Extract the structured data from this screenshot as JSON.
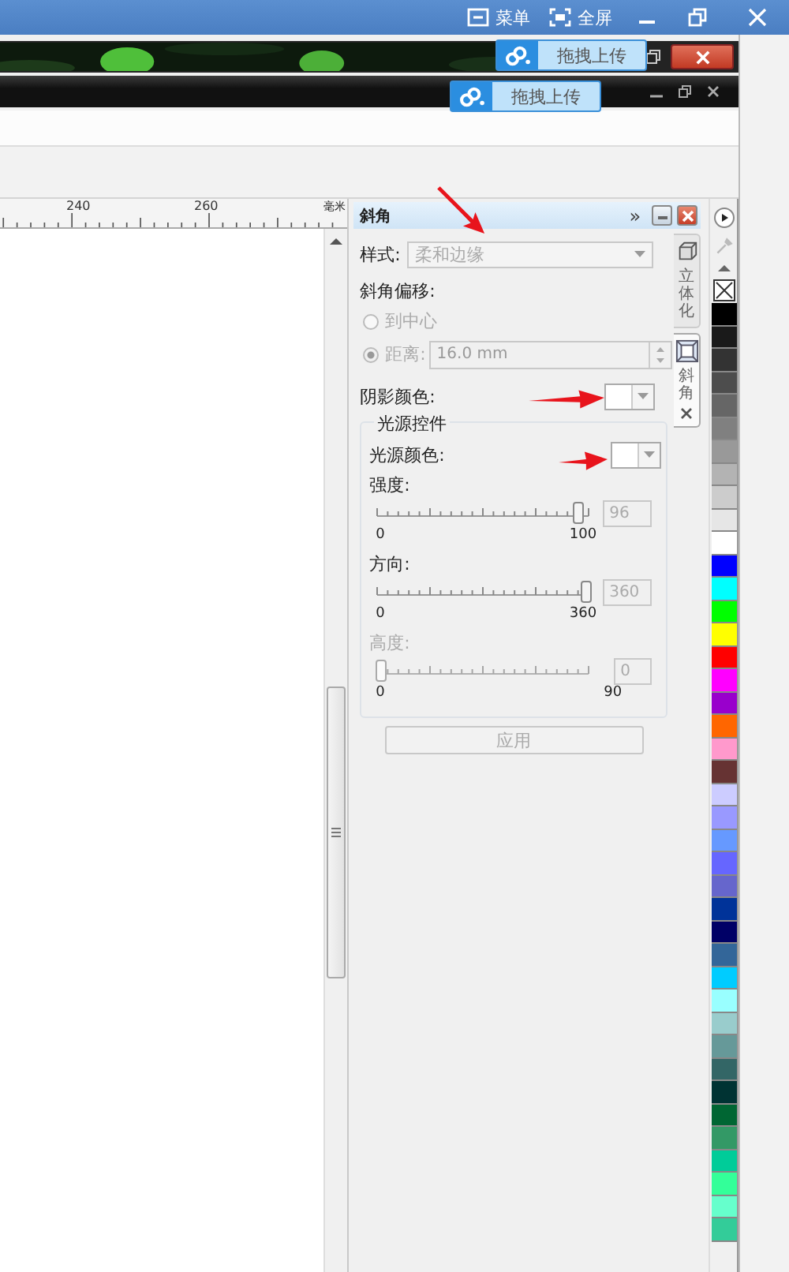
{
  "window": {
    "menu_label": "菜单",
    "fullscreen_label": "全屏"
  },
  "upload_buttons": [
    {
      "label": "拖拽上传"
    },
    {
      "label": "拖拽上传"
    }
  ],
  "ruler": {
    "ticks": [
      "240",
      "260"
    ],
    "unit": "毫米"
  },
  "docker": {
    "title": "斜角",
    "expand_glyph": "»",
    "style": {
      "label": "样式:",
      "value": "柔和边缘",
      "disabled": true
    },
    "offset": {
      "label": "斜角偏移:",
      "distance": "16.0 mm",
      "options": [
        {
          "label": "到中心",
          "selected": false
        },
        {
          "label": "距离:",
          "selected": true
        }
      ]
    },
    "shadow_color_label": "阴影颜色:",
    "light": {
      "title": "光源控件",
      "color_label": "光源颜色:",
      "sliders": [
        {
          "label": "强度:",
          "level": 0.96,
          "value": "96",
          "min": "0",
          "max": "100",
          "disabled": false
        },
        {
          "label": "方向:",
          "level": 1,
          "value": "360",
          "min": "0",
          "max": "360",
          "disabled": false
        },
        {
          "label": "高度:",
          "level": 0,
          "value": "0",
          "min": "0",
          "max": "90",
          "disabled": true
        }
      ]
    },
    "apply_button": "应用",
    "tabs": [
      {
        "label": "立体化",
        "selected": false
      },
      {
        "label": "斜角",
        "selected": true
      }
    ]
  },
  "palette": {
    "swatches": [
      {
        "color": "#000000"
      },
      {
        "color": "#1a1a1a"
      },
      {
        "color": "#333333"
      },
      {
        "color": "#4d4d4d"
      },
      {
        "color": "#666666"
      },
      {
        "color": "#808080"
      },
      {
        "color": "#999999"
      },
      {
        "color": "#b3b3b3"
      },
      {
        "color": "#cccccc"
      },
      {
        "color": "#e6e6e6"
      },
      {
        "color": "#ffffff"
      },
      {
        "color": "#0000ff"
      },
      {
        "color": "#00ffff"
      },
      {
        "color": "#00ff00"
      },
      {
        "color": "#ffff00"
      },
      {
        "color": "#ff0000"
      },
      {
        "color": "#ff00ff"
      },
      {
        "color": "#9900cc"
      },
      {
        "color": "#ff6600"
      },
      {
        "color": "#ff99cc"
      },
      {
        "color": "#663333"
      },
      {
        "color": "#ccccff"
      },
      {
        "color": "#9999ff"
      },
      {
        "color": "#6699ff"
      },
      {
        "color": "#6666ff"
      },
      {
        "color": "#6666cc"
      },
      {
        "color": "#003399"
      },
      {
        "color": "#000066"
      },
      {
        "color": "#336699"
      },
      {
        "color": "#00ccff"
      },
      {
        "color": "#99ffff"
      },
      {
        "color": "#99cccc"
      },
      {
        "color": "#669999"
      },
      {
        "color": "#336666"
      },
      {
        "color": "#003333"
      },
      {
        "color": "#006633"
      },
      {
        "color": "#339966"
      },
      {
        "color": "#00cc99"
      },
      {
        "color": "#33ff99"
      },
      {
        "color": "#66ffcc"
      },
      {
        "color": "#33cc99"
      }
    ]
  }
}
